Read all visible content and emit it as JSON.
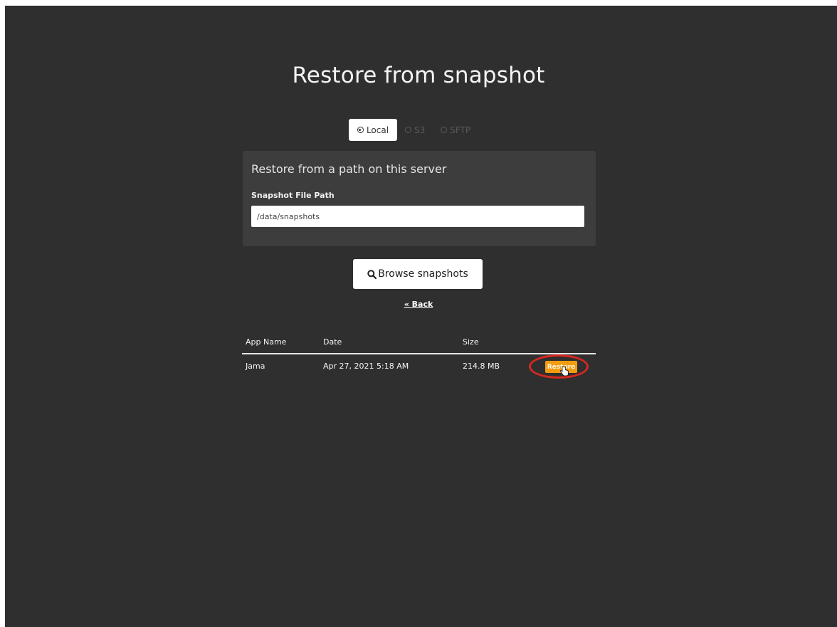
{
  "page": {
    "title": "Restore from snapshot"
  },
  "tabs": [
    {
      "label": "Local",
      "selected": true
    },
    {
      "label": "S3",
      "selected": false
    },
    {
      "label": "SFTP",
      "selected": false
    }
  ],
  "panel": {
    "heading": "Restore from a path on this server",
    "field_label": "Snapshot File Path",
    "path_value": "/data/snapshots"
  },
  "browse_button": {
    "label": "Browse snapshots",
    "icon": "search-icon"
  },
  "back_link": "« Back",
  "table": {
    "headers": [
      "App Name",
      "Date",
      "Size"
    ],
    "rows": [
      {
        "app_name": "Jama",
        "date": "Apr 27, 2021 5:18 AM",
        "size": "214.8 MB",
        "action": "Restore"
      }
    ]
  },
  "colors": {
    "background": "#2f2f2f",
    "panel": "#3d3d3d",
    "restore_button": "#f39c12",
    "highlight": "#d5281f"
  }
}
